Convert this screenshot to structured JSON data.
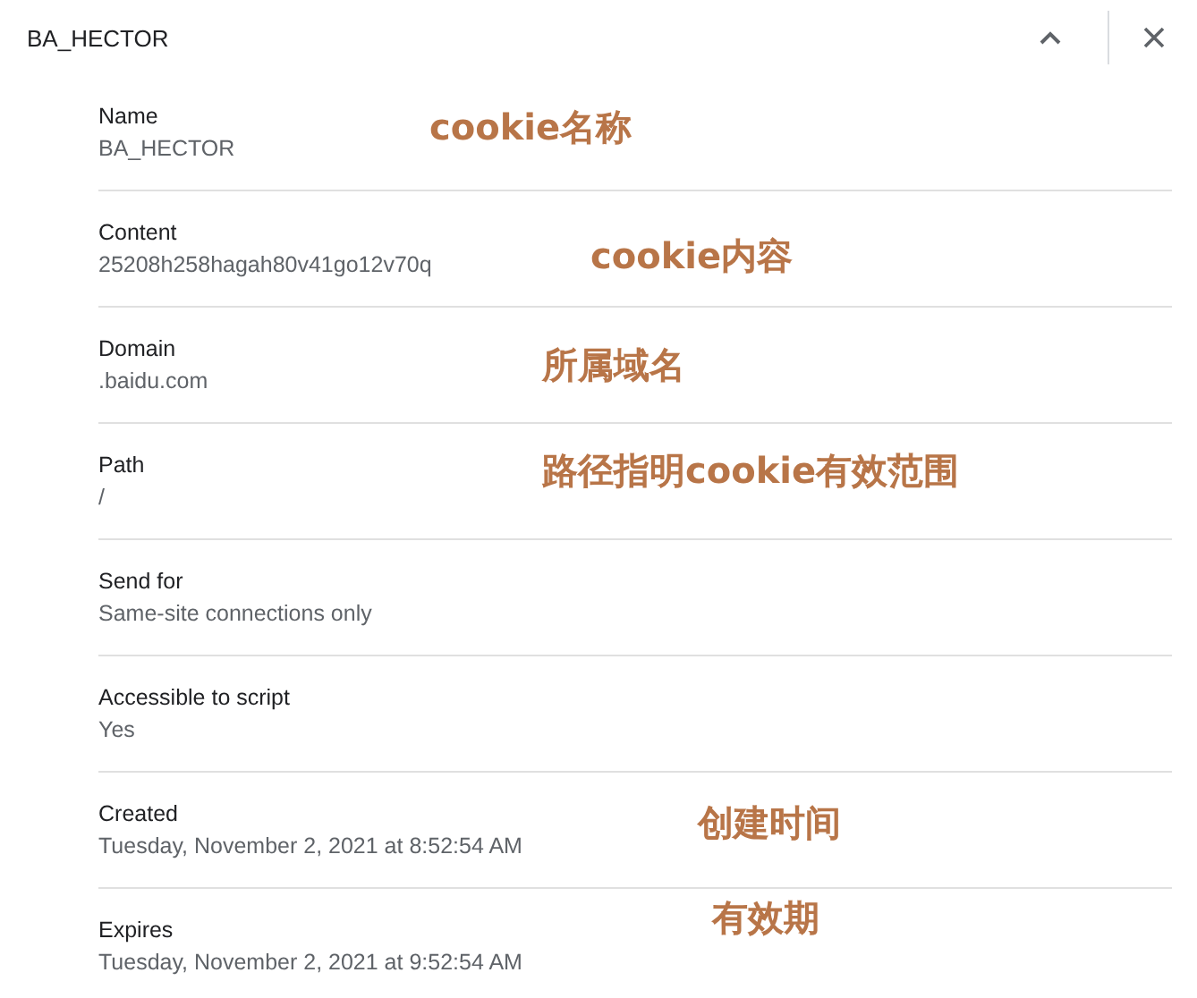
{
  "header": {
    "title": "BA_HECTOR"
  },
  "fields": [
    {
      "label": "Name",
      "value": "BA_HECTOR",
      "annotation": "cookie名称"
    },
    {
      "label": "Content",
      "value": "25208h258hagah80v41go12v70q",
      "annotation": "cookie内容"
    },
    {
      "label": "Domain",
      "value": ".baidu.com",
      "annotation": "所属域名"
    },
    {
      "label": "Path",
      "value": "/",
      "annotation": "路径指明cookie有效范围"
    },
    {
      "label": "Send for",
      "value": "Same-site connections only"
    },
    {
      "label": "Accessible to script",
      "value": "Yes"
    },
    {
      "label": "Created",
      "value": "Tuesday, November 2, 2021 at 8:52:54 AM",
      "annotation": "创建时间"
    },
    {
      "label": "Expires",
      "value": "Tuesday, November 2, 2021 at 9:52:54 AM",
      "annotation": "有效期"
    }
  ]
}
